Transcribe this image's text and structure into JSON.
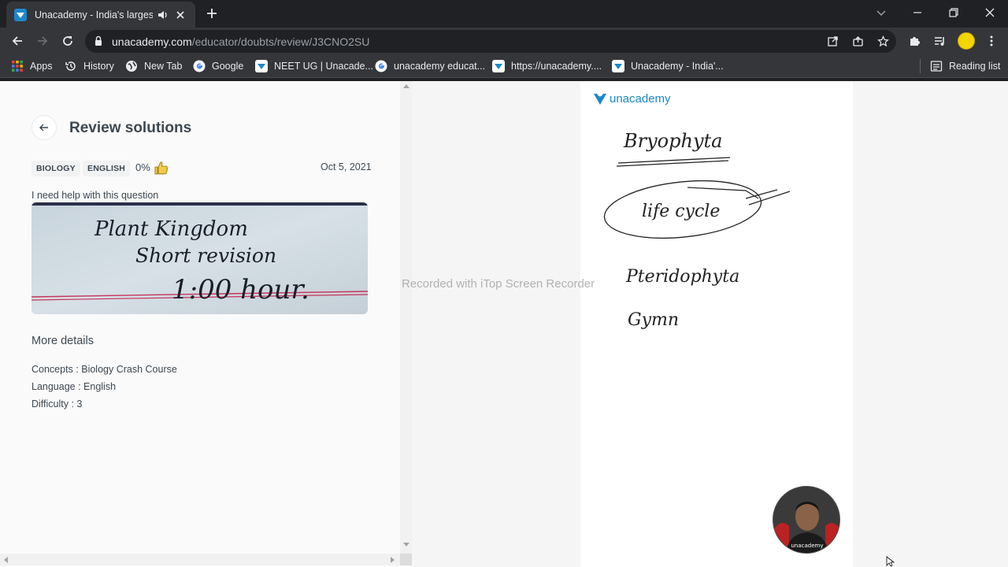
{
  "browser": {
    "tab": {
      "title": "Unacademy - India's largest l"
    },
    "url": {
      "host": "unacademy.com",
      "path": "/educator/doubts/review/J3CNO2SU"
    },
    "bookmarks": [
      {
        "label": "Apps",
        "icon": "apps-grid-icon"
      },
      {
        "label": "History",
        "icon": "history-icon"
      },
      {
        "label": "New Tab",
        "icon": "globe-icon"
      },
      {
        "label": "Google",
        "icon": "google-icon"
      },
      {
        "label": "NEET UG | Unacade...",
        "icon": "unacademy-icon"
      },
      {
        "label": "unacademy educat...",
        "icon": "google-icon"
      },
      {
        "label": "https://unacademy....",
        "icon": "unacademy-icon"
      },
      {
        "label": "Unacademy - India'...",
        "icon": "unacademy-icon"
      }
    ],
    "reading_list": "Reading list"
  },
  "review": {
    "title": "Review solutions",
    "tags": [
      "BIOLOGY",
      "ENGLISH"
    ],
    "percent": "0%",
    "date": "Oct 5, 2021",
    "question_text": "I need help with this question",
    "question_image_lines": [
      "Plant Kingdom",
      "Short revision",
      "1:00 hour."
    ],
    "more_details_title": "More details",
    "details": [
      "Concepts : Biology Crash Course",
      "Language : English",
      "Difficulty : 3"
    ]
  },
  "board": {
    "brand": "unacademy",
    "handwriting": [
      "Bryophyta",
      "life cycle",
      "Pteridophyta",
      "Gymn"
    ]
  },
  "overlay": {
    "watermark": "Recorded with iTop Screen Recorder",
    "webcam_brand": "unacademy"
  },
  "colors": {
    "brand_blue": "#1b88c9",
    "text_dark": "#3c4852"
  }
}
